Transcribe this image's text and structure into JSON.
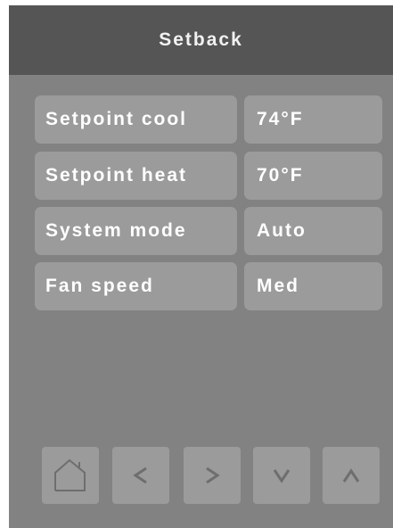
{
  "header": {
    "title": "Setback"
  },
  "rows": [
    {
      "label": "Setpoint cool",
      "value": "74°F"
    },
    {
      "label": "Setpoint heat",
      "value": "70°F"
    },
    {
      "label": "System mode",
      "value": "Auto"
    },
    {
      "label": "Fan speed",
      "value": "Med"
    }
  ],
  "nav": {
    "icons": [
      "home-icon",
      "chevron-left-icon",
      "chevron-right-icon",
      "chevron-down-icon",
      "chevron-up-icon"
    ]
  },
  "colors": {
    "header_bg": "#555555",
    "panel_bg": "#828282",
    "cell_bg": "#9b9b9b",
    "text": "#ffffff"
  }
}
